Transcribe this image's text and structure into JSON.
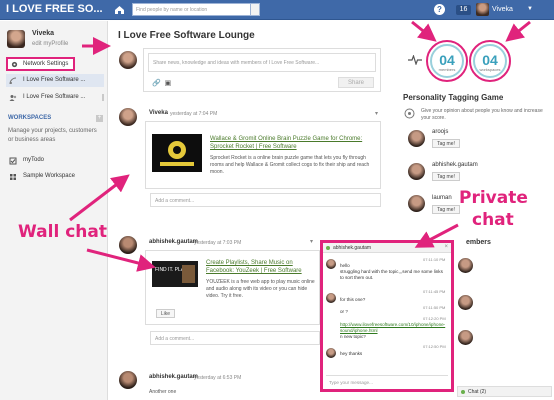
{
  "topbar": {
    "brand": "I LOVE FREE SO...",
    "search_placeholder": "Find people by name or location",
    "notification_count": "16",
    "user_name": "Viveka"
  },
  "sidebar": {
    "profile_name": "Viveka",
    "edit_profile": "edit myProfile",
    "network_settings": "Network Settings",
    "items": [
      {
        "label": "I Love Free Software ..."
      },
      {
        "label": "I Love Free Software ..."
      }
    ],
    "workspaces_label": "WORKSPACES",
    "workspaces_desc": "Manage your projects, customers or business areas",
    "ws_items": [
      {
        "label": "myTodo"
      },
      {
        "label": "Sample Workspace"
      }
    ]
  },
  "main": {
    "title": "I Love Free Software Lounge",
    "share_placeholder": "Share news, knowledge and ideas with members of I Love Free Software...",
    "share_button": "Share",
    "posts": [
      {
        "author": "Viveka",
        "time": "yesterday at 7:04 PM",
        "link_title": "Wallace & Gromit Online Brain Puzzle Game for Chrome: Sprocket Rocket | Free Software",
        "desc": "Sprocket Rocket is a online brain puzzle game that lets you fly through rooms and help Wallace & Gromit collect cogs to fix their ship and reach moon.",
        "comment_placeholder": "Add a comment..."
      },
      {
        "author": "abhishek.gautam",
        "time": "yesterday at 7:03 PM",
        "link_title": "Create Playlists, Share Music on Facebook: YouZeek | Free Software",
        "desc": "YOUZEEK is a free web app to play music online and audio along with its video or you can hide video. Try it free.",
        "like": "Like",
        "comment_placeholder": "Add a comment..."
      },
      {
        "author": "abhishek.gautam",
        "time": "yesterday at 6:53 PM",
        "desc": "Another one"
      }
    ]
  },
  "right": {
    "members_count": "04",
    "members_label": "members",
    "workspaces_count": "04",
    "workspaces_label": "workspaces",
    "ptg_title": "Personality Tagging Game",
    "ptg_desc": "Give your opinion about people you know and increase your score.",
    "tag_people": [
      {
        "name": "aroojs",
        "button": "Tag me!"
      },
      {
        "name": "abhishek.gautam",
        "button": "Tag me!"
      },
      {
        "name": "lauman",
        "button": "Tag me!"
      }
    ],
    "members_heading_fragment": "embers"
  },
  "chat": {
    "header": "abhishek.gautam",
    "messages": [
      {
        "time": "07:11:10 PM",
        "text_lines": [
          "hello",
          "struggling hard with the topic,,,send me some links",
          "to sort them out."
        ]
      },
      {
        "time": "07:11:45 PM",
        "text_lines": [
          "for this one?"
        ]
      },
      {
        "time": "07:11:50 PM",
        "text_lines": [
          "or ?"
        ]
      },
      {
        "time": "07:12:20 PM",
        "text_lines": [
          "http://www.ilovefreesoftware.com/10/iphone/iphone-sound/iphone.html",
          "n new topic?"
        ]
      },
      {
        "time": "07:12:50 PM",
        "text_lines": [
          "hey thanks"
        ]
      }
    ],
    "input_placeholder": "Type your message...",
    "tab_label": "Chat (2)"
  },
  "annotations": {
    "wall_chat": "Wall chat",
    "private_chat_1": "Private",
    "private_chat_2": "chat",
    "color": "#e0237c"
  }
}
